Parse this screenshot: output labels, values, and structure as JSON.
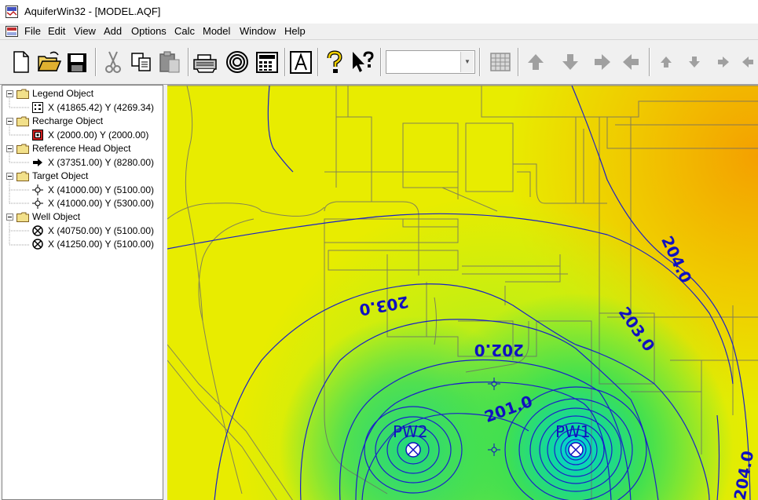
{
  "window": {
    "title": "AquiferWin32 - [MODEL.AQF]"
  },
  "menu": {
    "items": [
      "File",
      "Edit",
      "View",
      "Add",
      "Options",
      "Calc",
      "Model",
      "Window",
      "Help"
    ]
  },
  "toolbar": {
    "buttons": [
      "new-file-icon",
      "open-folder-icon",
      "save-disk-icon",
      "cut-scissors-icon",
      "copy-icon",
      "paste-icon",
      "print-icon",
      "target-circles-icon",
      "calculator-icon",
      "text-a-icon",
      "help-question-icon",
      "context-help-icon"
    ],
    "combo_value": "",
    "nav_buttons": [
      "grid-icon",
      "arrow-up-icon",
      "arrow-down-icon",
      "arrow-right-icon",
      "arrow-left-icon",
      "small-up-icon",
      "small-down-icon",
      "small-right-icon",
      "small-left-icon"
    ]
  },
  "tree": {
    "groups": [
      {
        "label": "Legend Object",
        "items": [
          {
            "icon": "legend-icon",
            "text": "X (41865.42)  Y (4269.34)"
          }
        ]
      },
      {
        "label": "Recharge Object",
        "items": [
          {
            "icon": "recharge-icon",
            "text": "X (2000.00)  Y (2000.00)"
          }
        ]
      },
      {
        "label": "Reference Head Object",
        "items": [
          {
            "icon": "arrow-right-icon",
            "text": "X (37351.00)  Y (8280.00)"
          }
        ]
      },
      {
        "label": "Target Object",
        "items": [
          {
            "icon": "crosshair-icon",
            "text": "X (41000.00)  Y (5100.00)"
          },
          {
            "icon": "crosshair-icon",
            "text": "X (41000.00)  Y (5300.00)"
          }
        ]
      },
      {
        "label": "Well Object",
        "items": [
          {
            "icon": "well-icon",
            "text": "X (40750.00)  Y (5100.00)"
          },
          {
            "icon": "well-icon",
            "text": "X (41250.00)  Y (5100.00)"
          }
        ]
      }
    ]
  },
  "map": {
    "wells": [
      {
        "label": "PW2"
      },
      {
        "label": "PW1"
      }
    ],
    "contour_labels": [
      "203.0",
      "204.0",
      "203.0",
      "202.0",
      "201.0",
      "204.0"
    ],
    "contour_color": "#1010c0",
    "colors": {
      "low": "#10d070",
      "mid": "#b8ee00",
      "high": "#f4a000"
    }
  }
}
